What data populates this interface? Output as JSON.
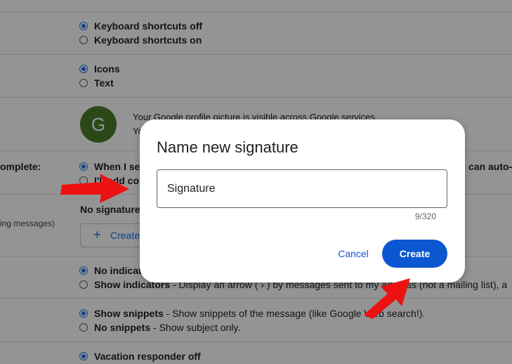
{
  "settings": {
    "top_partial_text": "",
    "keyboard": {
      "options": [
        {
          "label": "Keyboard shortcuts off",
          "selected": true
        },
        {
          "label": "Keyboard shortcuts on",
          "selected": false
        }
      ]
    },
    "button_labels": {
      "options": [
        {
          "label": "Icons",
          "selected": true
        },
        {
          "label": "Text",
          "selected": false
        }
      ]
    },
    "my_picture": {
      "avatar_letter": "G",
      "line1": "Your Google profile picture is visible across Google services.",
      "line2": "Yo"
    },
    "autocomplete": {
      "label": "omplete:",
      "option1": "When I se",
      "option1_suffix": "can auto-",
      "option2": "I'll add co"
    },
    "signature": {
      "sublabel": "ing messages)",
      "no_signatures": "No signature",
      "create_label": "Create"
    },
    "indicators": {
      "option1": "No indicat",
      "option2_bold": "Show indicators",
      "option2_desc": " - Display an arrow ( › ) by messages sent to my address (not a mailing list), a"
    },
    "snippets": {
      "option1_bold": "Show snippets",
      "option1_desc": " - Show snippets of the message (like Google Web search!).",
      "option2_bold": "No snippets",
      "option2_desc": " - Show subject only."
    },
    "vacation": {
      "option1": "Vacation responder off"
    }
  },
  "dialog": {
    "title": "Name new signature",
    "input_value": "Signature",
    "counter": "9/320",
    "cancel_label": "Cancel",
    "create_label": "Create"
  },
  "colors": {
    "accent": "#0b57d0",
    "annotation_arrow": "#ee1111",
    "scrim": "rgba(0,0,0,0.42)"
  }
}
